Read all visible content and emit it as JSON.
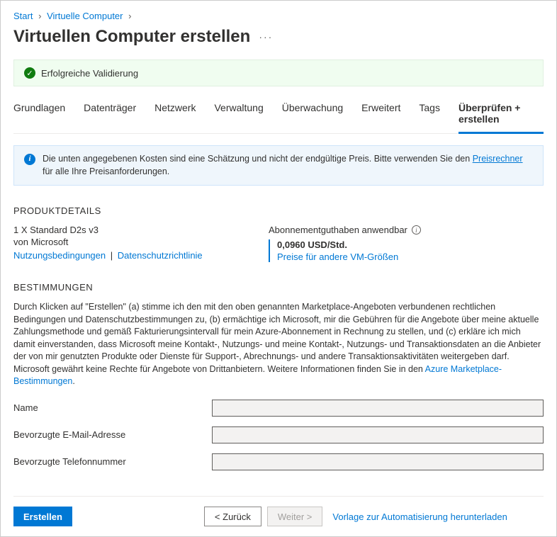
{
  "breadcrumb": {
    "start": "Start",
    "vms": "Virtuelle Computer"
  },
  "page_title": "Virtuellen Computer erstellen",
  "validation": {
    "message": "Erfolgreiche Validierung"
  },
  "tabs": {
    "basics": "Grundlagen",
    "disks": "Datenträger",
    "network": "Netzwerk",
    "management": "Verwaltung",
    "monitoring": "Überwachung",
    "advanced": "Erweitert",
    "tags": "Tags",
    "review": "Überprüfen + erstellen"
  },
  "info_box": {
    "text_pre": "Die unten angegebenen Kosten sind eine Schätzung und nicht der endgültige Preis. Bitte verwenden Sie den ",
    "link": "Preisrechner",
    "text_post": " für alle Ihre Preisanforderungen."
  },
  "product_details": {
    "header": "PRODUKTDETAILS",
    "sku": "1 X Standard D2s v3",
    "vendor": "von Microsoft",
    "terms_link": "Nutzungsbedingungen",
    "privacy_link": "Datenschutzrichtlinie",
    "credit_label": "Abonnementguthaben anwendbar",
    "price": "0,0960 USD/Std.",
    "sizes_link": "Preise für andere VM-Größen"
  },
  "terms": {
    "header": "BESTIMMUNGEN",
    "body_pre": "Durch Klicken auf \"Erstellen\" (a) stimme ich den mit den oben genannten Marketplace-Angeboten verbundenen rechtlichen Bedingungen und Datenschutzbestimmungen zu, (b) ermächtige ich Microsoft, mir die Gebühren für die Angebote über meine aktuelle Zahlungsmethode und gemäß Fakturierungsintervall für mein Azure-Abonnement in Rechnung zu stellen, und (c) erkläre ich mich damit einverstanden, dass Microsoft meine Kontakt-, Nutzungs- und meine Kontakt-, Nutzungs- und Transaktionsdaten an die Anbieter der von mir genutzten Produkte oder Dienste für Support-, Abrechnungs- und andere Transaktionsaktivitäten weitergeben darf. Microsoft gewährt keine Rechte für Angebote von Drittanbietern. Weitere Informationen finden Sie in den ",
    "link": "Azure Marketplace-Bestimmungen",
    "body_post": "."
  },
  "form": {
    "name_label": "Name",
    "email_label": "Bevorzugte E-Mail-Adresse",
    "phone_label": "Bevorzugte Telefonnummer"
  },
  "footer": {
    "create": "Erstellen",
    "back": "< Zurück",
    "next": "Weiter >",
    "template_link": "Vorlage zur Automatisierung herunterladen"
  }
}
